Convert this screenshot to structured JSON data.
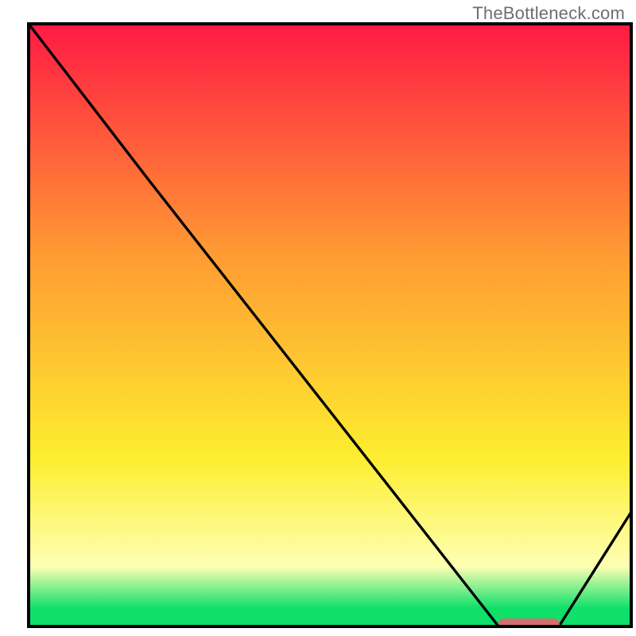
{
  "attribution": "TheBottleneck.com",
  "colors": {
    "red": "#ff1a44",
    "orange": "#ff9a33",
    "yellow": "#fdee2f",
    "lightyellow": "#ffffb3",
    "green": "#0ee06a",
    "black": "#000000",
    "bar": "#d2706f",
    "barshadow": "#b85b59"
  },
  "chart_data": {
    "type": "line",
    "title": "",
    "xlabel": "",
    "ylabel": "",
    "xlim": [
      0,
      100
    ],
    "ylim": [
      0,
      100
    ],
    "series": [
      {
        "name": "curve",
        "x": [
          0,
          20,
          78,
          88,
          100
        ],
        "y": [
          100,
          74,
          0,
          0,
          19
        ]
      }
    ],
    "annotations": [
      {
        "name": "optimum-bar",
        "x_start": 78,
        "x_end": 88,
        "y": 0
      }
    ]
  }
}
